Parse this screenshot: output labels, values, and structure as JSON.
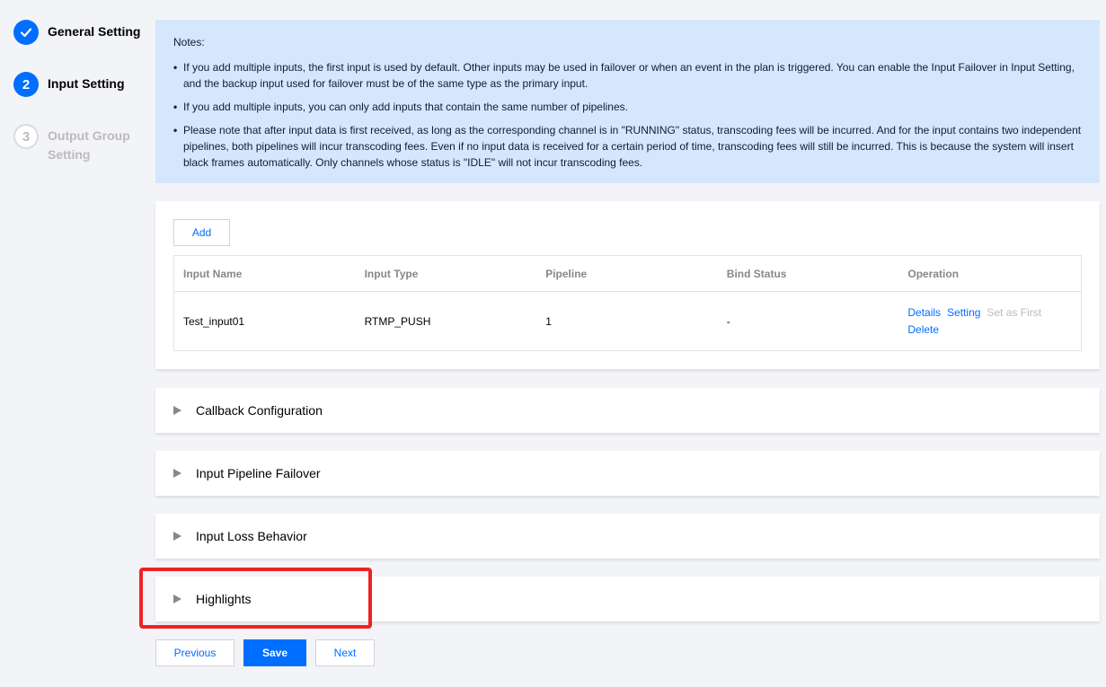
{
  "stepper": {
    "steps": [
      {
        "number": "✓",
        "label": "General Setting",
        "state": "done"
      },
      {
        "number": "2",
        "label": "Input Setting",
        "state": "active"
      },
      {
        "number": "3",
        "label": "Output Group Setting",
        "state": "todo"
      }
    ]
  },
  "notes": {
    "title": "Notes:",
    "items": [
      "If you add multiple inputs, the first input is used by default. Other inputs may be used in failover or when an event in the plan is triggered. You can enable the Input Failover in Input Setting, and the backup input used for failover must be of the same type as the primary input.",
      "If you add multiple inputs, you can only add inputs that contain the same number of pipelines.",
      "Please note that after input data is first received, as long as the corresponding channel is in \"RUNNING\" status, transcoding fees will be incurred. And for the input contains two independent pipelines, both pipelines will incur transcoding fees. Even if no input data is received for a certain period of time, transcoding fees will still be incurred. This is because the system will insert black frames automatically. Only channels whose status is \"IDLE\" will not incur transcoding fees."
    ]
  },
  "inputs": {
    "add_label": "Add",
    "columns": [
      "Input Name",
      "Input Type",
      "Pipeline",
      "Bind Status",
      "Operation"
    ],
    "rows": [
      {
        "name": "Test_input01",
        "type": "RTMP_PUSH",
        "pipeline": "1",
        "bind_status": "-",
        "ops": {
          "details": "Details",
          "setting": "Setting",
          "set_first": "Set as First",
          "delete": "Delete"
        }
      }
    ]
  },
  "sections": {
    "callback": "Callback Configuration",
    "failover": "Input Pipeline Failover",
    "loss": "Input Loss Behavior",
    "highlights": "Highlights"
  },
  "footer": {
    "previous": "Previous",
    "save": "Save",
    "next": "Next"
  },
  "colors": {
    "accent": "#006eff",
    "notes_bg": "#d5e7fd",
    "highlight_border": "#ee2222"
  }
}
